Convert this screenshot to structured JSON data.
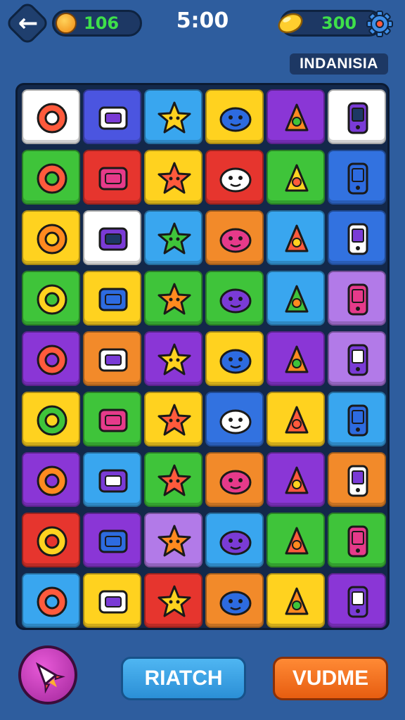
{
  "header": {
    "back_icon": "arrow-left-icon",
    "coins": "106",
    "coin_icon": "coin-face-icon",
    "timer": "5:00",
    "lemons": "300",
    "lemon_icon": "lemon-icon",
    "settings_icon": "gear-icon"
  },
  "country_label": "INDANISIA",
  "board": {
    "rows": 9,
    "cols": 6,
    "tiles": [
      {
        "bg": "#ffffff",
        "icon": "garuda-emblem-icon"
      },
      {
        "bg": "#4b55e0",
        "icon": "seal-icon"
      },
      {
        "bg": "#39a6ef",
        "icon": "lightbulb-icon"
      },
      {
        "bg": "#ffd21f",
        "icon": "sofa-icon"
      },
      {
        "bg": "#8a36d6",
        "icon": "target-ring-icon"
      },
      {
        "bg": "#ffffff",
        "icon": "purple-blob-icon"
      },
      {
        "bg": "#3fc43a",
        "icon": "bus-icon"
      },
      {
        "bg": "#e6352e",
        "icon": "tv-console-icon"
      },
      {
        "bg": "#ffd21f",
        "icon": "green-alien-icon"
      },
      {
        "bg": "#e6352e",
        "icon": "blue-crown-icon"
      },
      {
        "bg": "#3fc43a",
        "icon": "orange-fish-icon"
      },
      {
        "bg": "#3272e0",
        "icon": "swirl-icon"
      },
      {
        "bg": "#ffd21f",
        "icon": "ring-icon"
      },
      {
        "bg": "#ffffff",
        "icon": "bowtie-icon"
      },
      {
        "bg": "#39a6ef",
        "icon": "island-map-icon"
      },
      {
        "bg": "#f28a2a",
        "icon": "phone-bottle-icon"
      },
      {
        "bg": "#39a6ef",
        "icon": "monkey-face-icon"
      },
      {
        "bg": "#3272e0",
        "icon": "book-icon"
      },
      {
        "bg": "#3fc43a",
        "icon": "cloud-blob-icon"
      },
      {
        "bg": "#ffd21f",
        "icon": "truck-icon"
      },
      {
        "bg": "#3fc43a",
        "icon": "cat-face-icon"
      },
      {
        "bg": "#3fc43a",
        "icon": "dice-icon"
      },
      {
        "bg": "#39a6ef",
        "icon": "fish-creature-icon"
      },
      {
        "bg": "#b27ae8",
        "icon": "sun-face-icon"
      },
      {
        "bg": "#8a36d6",
        "icon": "cog-icon"
      },
      {
        "bg": "#f28a2a",
        "icon": "monster-head-icon"
      },
      {
        "bg": "#8a36d6",
        "icon": "crab-icon"
      },
      {
        "bg": "#ffd21f",
        "icon": "star-face-icon"
      },
      {
        "bg": "#8a36d6",
        "icon": "orange-splat-icon"
      },
      {
        "bg": "#b27ae8",
        "icon": "letter-a-icon"
      },
      {
        "bg": "#ffd21f",
        "icon": "bag-icon"
      },
      {
        "bg": "#3fc43a",
        "icon": "pink-puzzle-icon"
      },
      {
        "bg": "#ffd21f",
        "icon": "red-gem-icon"
      },
      {
        "bg": "#3272e0",
        "icon": "bottle-icon"
      },
      {
        "bg": "#ffd21f",
        "icon": "books-icon"
      },
      {
        "bg": "#39a6ef",
        "icon": "phone-card-icon"
      },
      {
        "bg": "#8a36d6",
        "icon": "popsicle-icon"
      },
      {
        "bg": "#39a6ef",
        "icon": "skateboard-icon"
      },
      {
        "bg": "#3fc43a",
        "icon": "sun-icon"
      },
      {
        "bg": "#f28a2a",
        "icon": "blue-star-icon"
      },
      {
        "bg": "#8a36d6",
        "icon": "green-ring-icon"
      },
      {
        "bg": "#f28a2a",
        "icon": "rocket-icon"
      },
      {
        "bg": "#e6352e",
        "icon": "star-creature-icon"
      },
      {
        "bg": "#8a36d6",
        "icon": "candy-icon"
      },
      {
        "bg": "#b27ae8",
        "icon": "orange-leaf-icon"
      },
      {
        "bg": "#39a6ef",
        "icon": "yellow-splash-icon"
      },
      {
        "bg": "#3fc43a",
        "icon": "green-monster-icon"
      },
      {
        "bg": "#3fc43a",
        "icon": "device-icon"
      },
      {
        "bg": "#39a6ef",
        "icon": "pink-ring-icon"
      },
      {
        "bg": "#ffd21f",
        "icon": "blue-bird-icon"
      },
      {
        "bg": "#e6352e",
        "icon": "orange-bug-icon"
      },
      {
        "bg": "#f28a2a",
        "icon": "paddle-icon"
      },
      {
        "bg": "#ffd21f",
        "icon": "magnifier-icon"
      },
      {
        "bg": "#8a36d6",
        "icon": "card-icon"
      }
    ]
  },
  "footer": {
    "rocket_icon": "rocket-icon",
    "match_label": "RIATCH",
    "vote_label": "VUDME"
  }
}
